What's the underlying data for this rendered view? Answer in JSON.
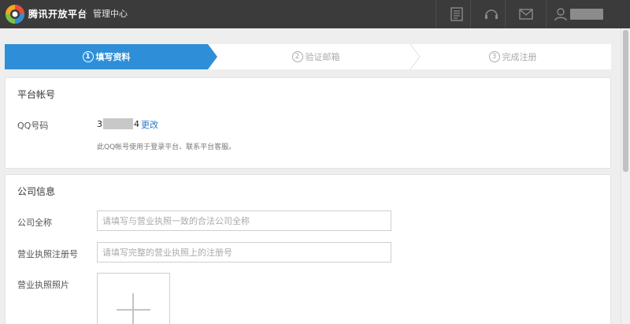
{
  "header": {
    "brand": "腾讯开放平台",
    "subtitle": "管理中心",
    "icons": [
      "document-icon",
      "headset-icon",
      "mail-icon",
      "user-icon"
    ],
    "colors": {
      "bar": "#3b3b3b",
      "accent": "#2e8fd8"
    }
  },
  "steps": [
    {
      "num": "1",
      "label": "填写资料",
      "state": "active"
    },
    {
      "num": "2",
      "label": "验证邮箱",
      "state": "inactive"
    },
    {
      "num": "3",
      "label": "完成注册",
      "state": "inactive"
    }
  ],
  "account": {
    "title": "平台帐号",
    "qq_label": "QQ号码",
    "qq_prefix": "3",
    "qq_suffix": "4",
    "change_label": "更改",
    "hint": "此QQ帐号使用于登录平台、联系平台客服。"
  },
  "company": {
    "title": "公司信息",
    "name_label": "公司全称",
    "name_placeholder": "请填写与营业执照一致的合法公司全称",
    "reg_label": "营业执照注册号",
    "reg_placeholder": "请填写完整的营业执照上的注册号",
    "photo_label": "营业执照照片"
  }
}
